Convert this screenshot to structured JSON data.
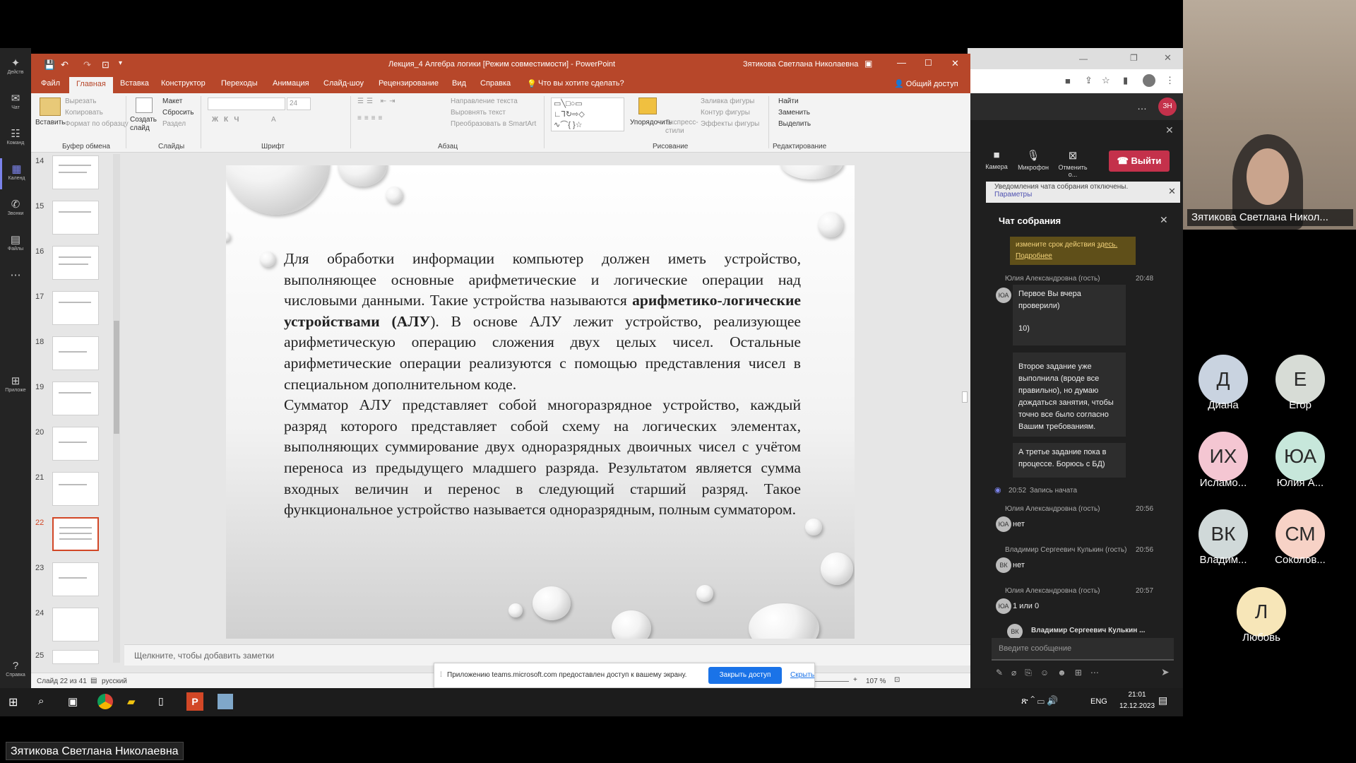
{
  "ppt": {
    "title": "Лекция_4 Алгебра логики [Режим совместимости] - PowerPoint",
    "user": "Зятикова Светлана Николаевна",
    "tabs": [
      "Файл",
      "Главная",
      "Вставка",
      "Конструктор",
      "Переходы",
      "Анимация",
      "Слайд-шоу",
      "Рецензирование",
      "Вид",
      "Справка"
    ],
    "tell_me": "Что вы хотите сделать?",
    "share": "Общий доступ",
    "ribbon": {
      "paste": "Вставить",
      "cut": "Вырезать",
      "copy": "Копировать",
      "format_painter": "Формат по образцу",
      "clipboard_group": "Буфер обмена",
      "new_slide": "Создать слайд",
      "layout": "Макет",
      "reset": "Сбросить",
      "section": "Раздел",
      "slides_group": "Слайды",
      "font_size": "24",
      "font_group": "Шрифт",
      "text_direction": "Направление текста",
      "align_text": "Выровнять текст",
      "smartart": "Преобразовать в SmartArt",
      "paragraph_group": "Абзац",
      "arrange": "Упорядочить",
      "quick_styles": "Экспресс-стили",
      "shape_fill": "Заливка фигуры",
      "shape_outline": "Контур фигуры",
      "shape_effects": "Эффекты фигуры",
      "drawing_group": "Рисование",
      "find": "Найти",
      "replace": "Заменить",
      "select": "Выделить",
      "editing_group": "Редактирование"
    },
    "thumbs": [
      "14",
      "15",
      "16",
      "17",
      "18",
      "19",
      "20",
      "21",
      "22",
      "23",
      "24",
      "25"
    ],
    "selected_slide": "22",
    "slide_text": {
      "p1_before": "Для обработки информации компьютер должен иметь устройство, выполняющее основные арифметические и логические операции над числовыми данными. Такие устройства называются ",
      "p1_bold": "арифметико-логические устройствами (АЛУ",
      "p1_after": "). В основе АЛУ лежит устройство, реализующее арифметическую операцию сложения двух целых чисел. Остальные арифметические операции реализуются с помощью представления чисел в специальном дополнительном коде.",
      "p2": "Сумматор АЛУ представляет собой многоразрядное устройство, каждый разряд которого представляет собой схему на логических элементах, выполняющих суммирование двух одноразрядных двоичных чисел с учётом переноса из предыдущего младшего разряда. Результатом является сумма входных величин и перенос в следующий старший разряд. Такое функциональное устройство называется одноразрядным, полным сумматором."
    },
    "notes_placeholder": "Щелкните, чтобы добавить заметки",
    "status": {
      "slide_of": "Слайд 22 из 41",
      "lang": "русский",
      "zoom": "107 %"
    },
    "sharebar": {
      "text": "Приложению teams.microsoft.com предоставлен доступ к вашему экрану.",
      "stop": "Закрыть доступ",
      "hide": "Скрыть"
    }
  },
  "rail": [
    {
      "label": "Действ",
      "icon": "bell-icon"
    },
    {
      "label": "Чат",
      "icon": "chat-icon"
    },
    {
      "label": "Команд",
      "icon": "teams-icon"
    },
    {
      "label": "Календ",
      "icon": "calendar-icon"
    },
    {
      "label": "Звонки",
      "icon": "phone-icon"
    },
    {
      "label": "Файлы",
      "icon": "file-icon"
    },
    {
      "label": "",
      "icon": "more-icon"
    },
    {
      "label": "Приложе",
      "icon": "apps-icon"
    },
    {
      "label": "Справка",
      "icon": "help-icon"
    }
  ],
  "meeting": {
    "camera": "Камера",
    "mic": "Микрофон",
    "cancel": "Отменить о...",
    "leave": "Выйти",
    "notice": "Уведомления чата собрания отключены.",
    "notice_link": "Параметры",
    "chat_title": "Чат собрания",
    "yellow_text": "измените срок действия",
    "yellow_link": "здесь.",
    "yellow_more": "Подробнее",
    "input_placeholder": "Введите сообщение",
    "avatar_initials": "ЗН"
  },
  "chat": [
    {
      "sender": "Юлия Александровна (гость)",
      "time": "20:48"
    },
    {
      "text": "Первое Вы вчера проверили)"
    },
    {
      "text": "10)"
    },
    {
      "text": "Второе задание уже выполнила (вроде все правильно), но думаю дождаться занятия, чтобы точно все было согласно Вашим требованиям."
    },
    {
      "text": "А третье задание пока в процессе. Борюсь с БД)"
    },
    {
      "system_time": "20:52",
      "system_text": "Запись начата"
    },
    {
      "sender": "Юлия Александровна (гость)",
      "time": "20:56",
      "text": "нет"
    },
    {
      "sender": "Владимир Сергеевич Кулькин (гость)",
      "time": "20:56",
      "text": "нет"
    },
    {
      "sender": "Юлия Александровна (гость)",
      "time": "20:57",
      "text": "1 или 0"
    },
    {
      "sender": "Владимир Сергеевич Кулькин ..."
    }
  ],
  "video_name": "Зятикова Светлана Никол...",
  "participants": [
    {
      "initials": "Д",
      "name": "Диана",
      "color": "#c9d3e0"
    },
    {
      "initials": "Е",
      "name": "Егор",
      "color": "#d7dcd6"
    },
    {
      "initials": "ИХ",
      "name": "Исламо...",
      "color": "#f4c6d2"
    },
    {
      "initials": "ЮА",
      "name": "Юлия А...",
      "color": "#c7e7db"
    },
    {
      "initials": "ВК",
      "name": "Владим...",
      "color": "#d0d9d9"
    },
    {
      "initials": "СМ",
      "name": "Соколов...",
      "color": "#f7d2c6"
    },
    {
      "initials": "Л",
      "name": "Любовь",
      "color": "#f7e6b8"
    }
  ],
  "taskbar": {
    "lang": "ENG",
    "time": "21:01",
    "date": "12.12.2023"
  },
  "bottom_label": "Зятикова Светлана Николаевна"
}
